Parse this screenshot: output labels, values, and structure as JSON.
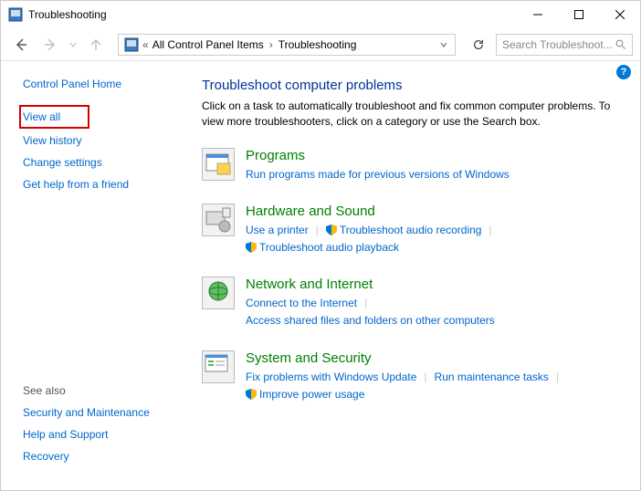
{
  "window": {
    "title": "Troubleshooting"
  },
  "breadcrumb": {
    "item1": "All Control Panel Items",
    "item2": "Troubleshooting"
  },
  "search": {
    "placeholder": "Search Troubleshoot..."
  },
  "sidebar": {
    "home": "Control Panel Home",
    "view_all": "View all",
    "view_history": "View history",
    "change_settings": "Change settings",
    "get_help": "Get help from a friend"
  },
  "see_also": {
    "header": "See also",
    "security": "Security and Maintenance",
    "help": "Help and Support",
    "recovery": "Recovery"
  },
  "main": {
    "title": "Troubleshoot computer problems",
    "desc": "Click on a task to automatically troubleshoot and fix common computer problems. To view more troubleshooters, click on a category or use the Search box."
  },
  "categories": {
    "programs": {
      "title": "Programs",
      "task1": "Run programs made for previous versions of Windows"
    },
    "hardware": {
      "title": "Hardware and Sound",
      "task1": "Use a printer",
      "task2": "Troubleshoot audio recording",
      "task3": "Troubleshoot audio playback"
    },
    "network": {
      "title": "Network and Internet",
      "task1": "Connect to the Internet",
      "task2": "Access shared files and folders on other computers"
    },
    "system": {
      "title": "System and Security",
      "task1": "Fix problems with Windows Update",
      "task2": "Run maintenance tasks",
      "task3": "Improve power usage"
    }
  }
}
